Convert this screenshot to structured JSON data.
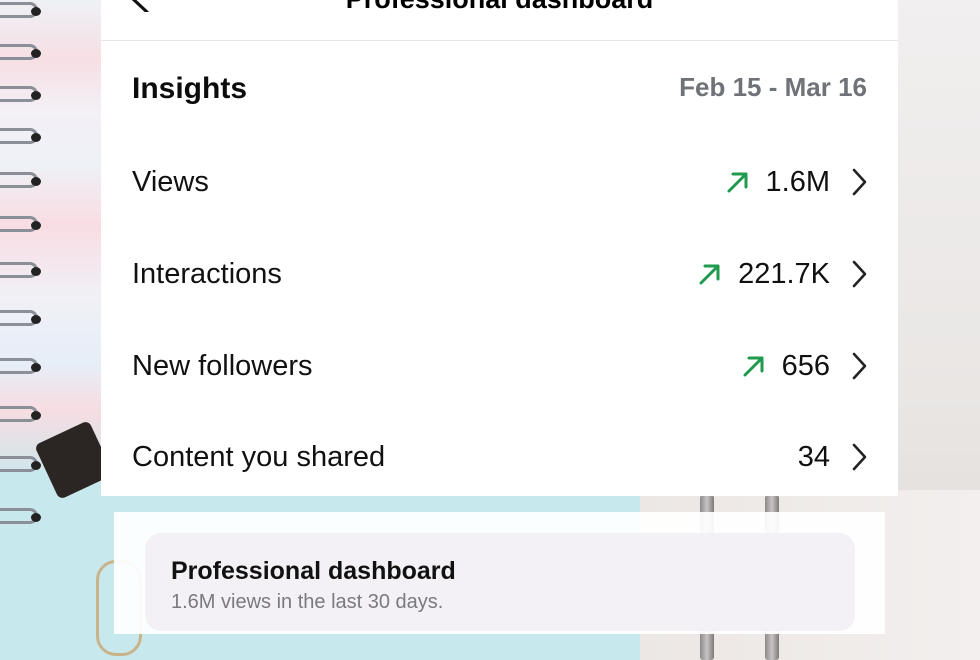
{
  "header": {
    "title": "Professional dashboard",
    "back_icon": "back-arrow-icon",
    "settings_icon": "gear-icon"
  },
  "insights": {
    "title": "Insights",
    "date_range": "Feb 15 - Mar 16",
    "rows": [
      {
        "label": "Views",
        "value": "1.6M",
        "trend": "up"
      },
      {
        "label": "Interactions",
        "value": "221.7K",
        "trend": "up"
      },
      {
        "label": "New followers",
        "value": "656",
        "trend": "up"
      },
      {
        "label": "Content you shared",
        "value": "34",
        "trend": "none"
      }
    ]
  },
  "bottom_card": {
    "title": "Professional dashboard",
    "subtitle": "1.6M views in the last 30 days."
  },
  "colors": {
    "trend_up": "#1f9a4e",
    "secondary_text": "#6f7378",
    "card_bg": "#ffffff"
  }
}
